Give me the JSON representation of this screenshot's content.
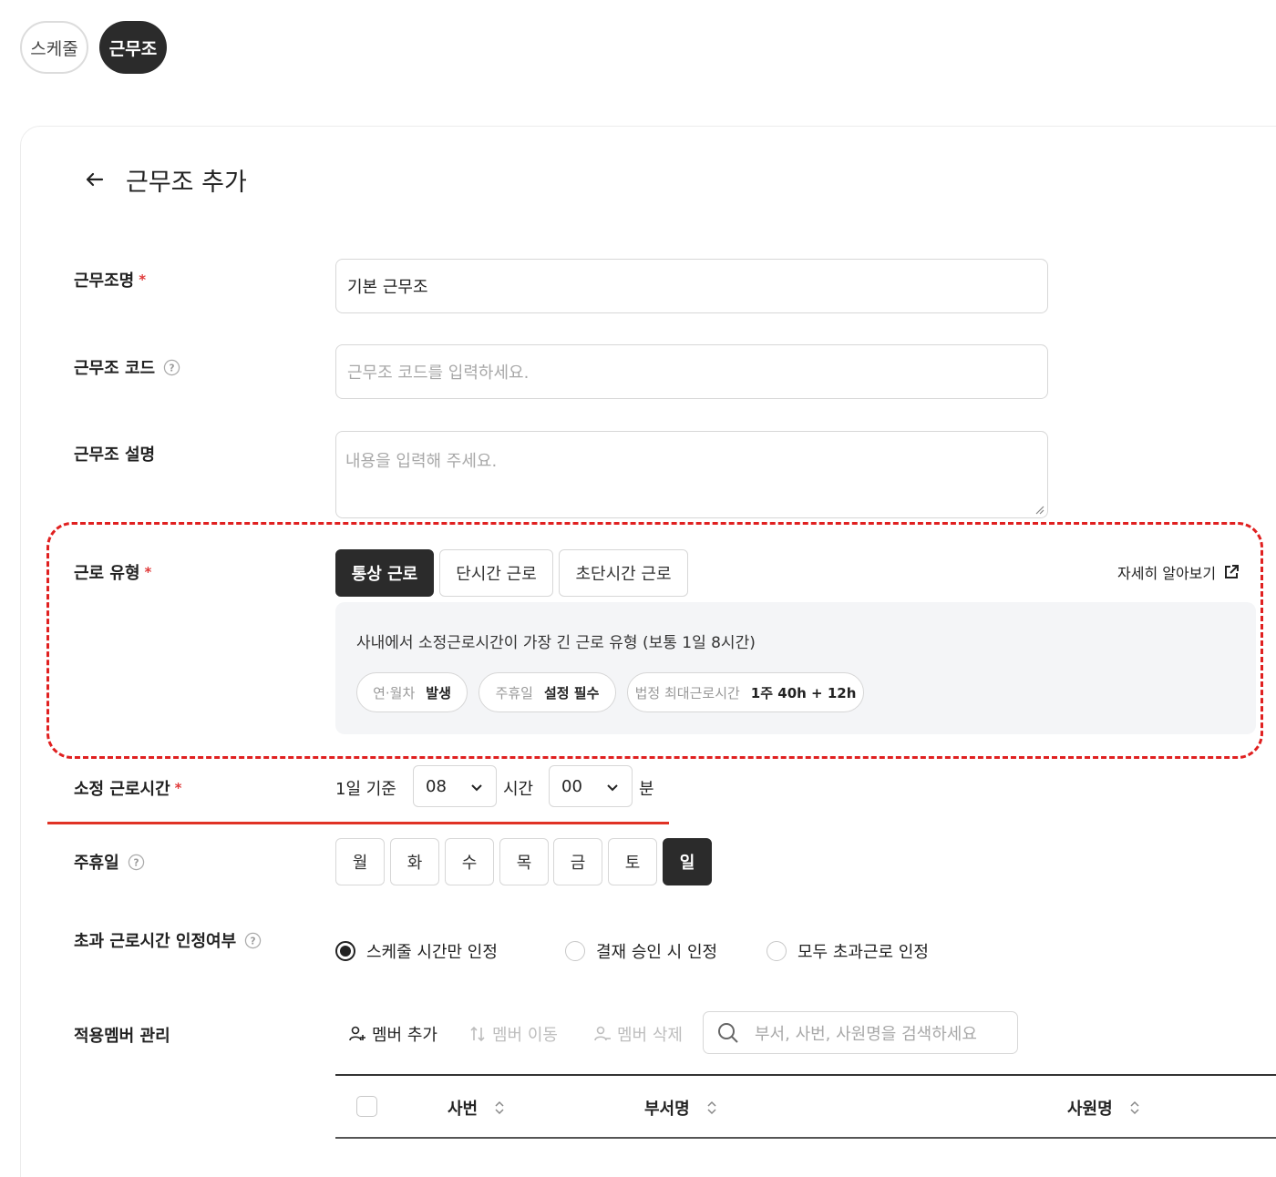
{
  "tabs": [
    {
      "label": "스케줄",
      "active": false
    },
    {
      "label": "근무조",
      "active": true
    }
  ],
  "header": {
    "title": "근무조 추가"
  },
  "form": {
    "name": {
      "label": "근무조명",
      "value": "기본 근무조",
      "required": true
    },
    "code": {
      "label": "근무조 코드",
      "placeholder": "근무조 코드를 입력하세요.",
      "has_help": true
    },
    "description": {
      "label": "근무조 설명",
      "placeholder": "내용을 입력해 주세요."
    },
    "work_type": {
      "label": "근로 유형",
      "required": true,
      "options": [
        "통상 근로",
        "단시간 근로",
        "초단시간 근로"
      ],
      "selected": "통상 근로",
      "learn_more": "자세히 알아보기",
      "description": "사내에서 소정근로시간이 가장 긴 근로 유형 (보통 1일 8시간)",
      "chips": [
        {
          "key": "연·월차",
          "value": "발생"
        },
        {
          "key": "주휴일",
          "value": "설정 필수"
        },
        {
          "key": "법정 최대근로시간",
          "value": "1주 40h + 12h"
        }
      ]
    },
    "work_hours": {
      "label": "소정 근로시간",
      "required": true,
      "prefix": "1일 기준",
      "hours": "08",
      "hours_unit": "시간",
      "minutes": "00",
      "minutes_unit": "분"
    },
    "weekly_holiday": {
      "label": "주휴일",
      "has_help": true,
      "days": [
        "월",
        "화",
        "수",
        "목",
        "금",
        "토",
        "일"
      ],
      "selected": "일"
    },
    "overtime": {
      "label": "초과 근로시간 인정여부",
      "has_help": true,
      "options": [
        "스케줄 시간만 인정",
        "결재 승인 시 인정",
        "모두 초과근로 인정"
      ],
      "selected": "스케줄 시간만 인정"
    },
    "members": {
      "label": "적용멤버 관리",
      "actions": [
        {
          "label": "멤버 추가",
          "enabled": true
        },
        {
          "label": "멤버 이동",
          "enabled": false
        },
        {
          "label": "멤버 삭제",
          "enabled": false
        }
      ],
      "search_placeholder": "부서, 사번, 사원명을 검색하세요",
      "columns": [
        "사번",
        "부서명",
        "사원명"
      ]
    }
  },
  "colors": {
    "dark": "#2b2b2b",
    "required": "#e03a3a",
    "highlight": "#e02020"
  }
}
